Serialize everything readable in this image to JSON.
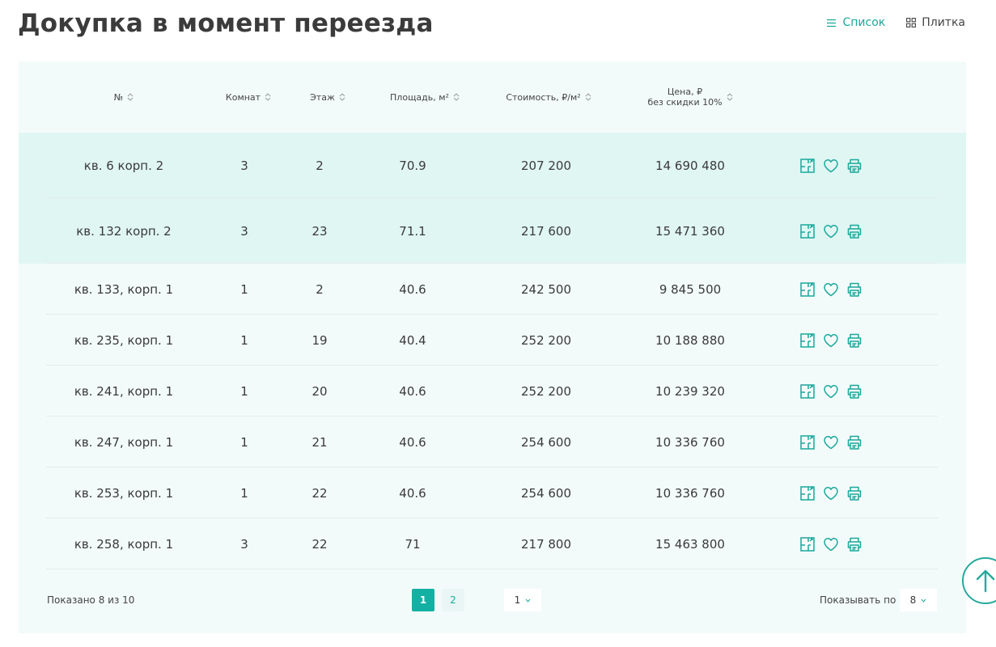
{
  "page": {
    "title": "Докупка в момент переезда"
  },
  "view_switch": {
    "list_label": "Список",
    "tile_label": "Плитка"
  },
  "table": {
    "headers": {
      "number": "№",
      "rooms": "Комнат",
      "floor": "Этаж",
      "area": "Площадь, м²",
      "price_per_m2": "Стоимость, ₽/м²",
      "price_line1": "Цена, ₽",
      "price_line2": "без скидки 10%"
    },
    "rows": [
      {
        "number": "кв. 6 корп. 2",
        "rooms": "3",
        "floor": "2",
        "area": "70.9",
        "price_per_m2": "207 200",
        "price": "14 690 480",
        "highlighted": true
      },
      {
        "number": "кв. 132 корп. 2",
        "rooms": "3",
        "floor": "23",
        "area": "71.1",
        "price_per_m2": "217 600",
        "price": "15 471 360",
        "highlighted": true
      },
      {
        "number": "кв. 133, корп. 1",
        "rooms": "1",
        "floor": "2",
        "area": "40.6",
        "price_per_m2": "242 500",
        "price": "9 845 500",
        "highlighted": false
      },
      {
        "number": "кв. 235, корп. 1",
        "rooms": "1",
        "floor": "19",
        "area": "40.4",
        "price_per_m2": "252 200",
        "price": "10 188 880",
        "highlighted": false
      },
      {
        "number": "кв. 241, корп. 1",
        "rooms": "1",
        "floor": "20",
        "area": "40.6",
        "price_per_m2": "252 200",
        "price": "10 239 320",
        "highlighted": false
      },
      {
        "number": "кв. 247, корп. 1",
        "rooms": "1",
        "floor": "21",
        "area": "40.6",
        "price_per_m2": "254 600",
        "price": "10 336 760",
        "highlighted": false
      },
      {
        "number": "кв. 253, корп. 1",
        "rooms": "1",
        "floor": "22",
        "area": "40.6",
        "price_per_m2": "254 600",
        "price": "10 336 760",
        "highlighted": false
      },
      {
        "number": "кв. 258, корп. 1",
        "rooms": "3",
        "floor": "22",
        "area": "71",
        "price_per_m2": "217 800",
        "price": "15 463 800",
        "highlighted": false
      }
    ],
    "row_icons": [
      "floorplan-icon",
      "heart-icon",
      "printer-icon"
    ]
  },
  "footer": {
    "shown_text": "Показано 8 из 10",
    "pages": [
      "1",
      "2"
    ],
    "current_page": "1",
    "page_select_value": "1",
    "per_page_label": "Показывать по",
    "per_page_value": "8"
  },
  "colors": {
    "accent": "#13b0a3",
    "panel_bg": "#f3fbfa",
    "highlight_row": "#e0f6f3"
  }
}
